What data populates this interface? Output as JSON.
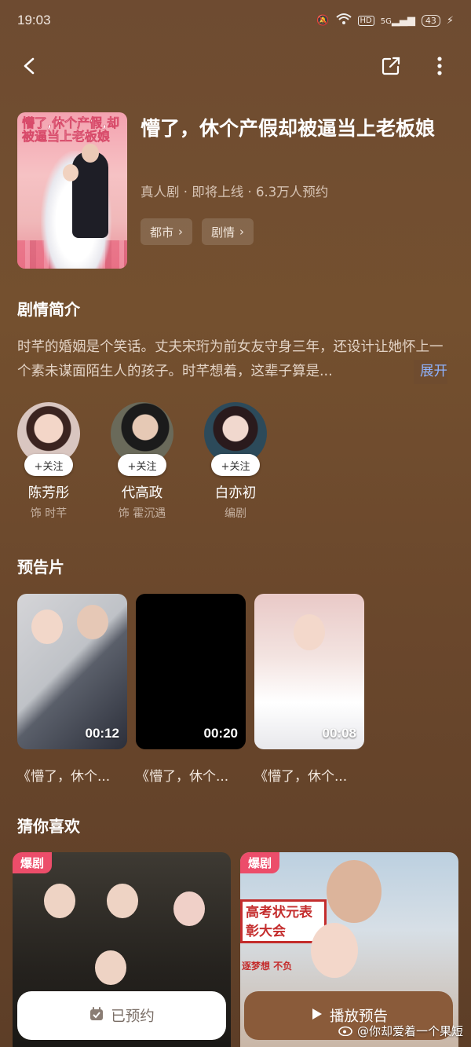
{
  "status": {
    "time": "19:03",
    "network": "5G",
    "hd": "HD",
    "battery": "43"
  },
  "header": {
    "back_icon": "back-arrow-icon",
    "share_icon": "share-icon",
    "more_icon": "more-vertical-icon"
  },
  "drama": {
    "title": "懵了，休个产假却被逼当上老板娘",
    "meta": "真人剧 · 即将上线 · 6.3万人预约",
    "tags": [
      "都市",
      "剧情"
    ],
    "poster_title": "懵了,休个产假,却被逼当上老板娘"
  },
  "synopsis": {
    "heading": "剧情简介",
    "text": "时芊的婚姻是个笑话。丈夫宋珩为前女友守身三年，还设计让她怀上一个素未谋面陌生人的孩子。时芊想着，这辈子算是...",
    "more_label": "展开"
  },
  "cast": [
    {
      "name": "陈芳彤",
      "role": "饰 时芊",
      "follow": "+关注"
    },
    {
      "name": "代高政",
      "role": "饰 霍沉遇",
      "follow": "+关注"
    },
    {
      "name": "白亦初",
      "role": "编剧",
      "follow": "+关注"
    }
  ],
  "trailers": {
    "heading": "预告片",
    "items": [
      {
        "duration": "00:12",
        "caption": "《懵了，休个..."
      },
      {
        "duration": "00:20",
        "caption": "《懵了，休个..."
      },
      {
        "duration": "00:08",
        "caption": "《懵了，休个..."
      }
    ]
  },
  "recommend": {
    "heading": "猜你喜欢",
    "badge": "爆剧",
    "right_banner": "高考状元表彰大会",
    "right_subtext": "逐梦想 不负"
  },
  "actions": {
    "booked_label": "已预约",
    "play_label": "播放预告"
  },
  "watermark": "@你却爱着一个果短",
  "colors": {
    "bg": "#6e4b31",
    "link": "#8fb3ff",
    "badge": "#ec4d6a",
    "play_btn": "#8a5b3a"
  }
}
